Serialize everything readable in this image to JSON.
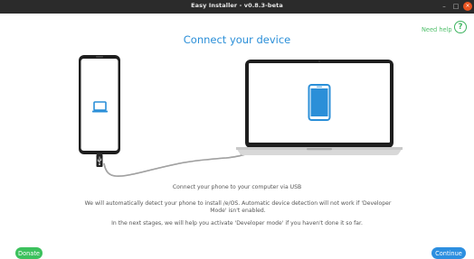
{
  "window": {
    "title": "Easy Installer - v0.8.3-beta",
    "minimize_glyph": "–",
    "maximize_glyph": "□",
    "close_glyph": "×"
  },
  "header": {
    "help_label": "Need help",
    "help_icon_glyph": "?",
    "title": "Connect your device"
  },
  "content": {
    "connect_text": "Connect your phone to your computer via USB",
    "detect_text": "We will automatically detect your phone to install /e/OS. Automatic device detection will not work if 'Developer Mode' isn't enabled.",
    "stages_text": "In the next stages, we will help you activate 'Developer mode' if you haven't done it so far."
  },
  "footer": {
    "donate_label": "Donate",
    "continue_label": "Continue"
  },
  "colors": {
    "accent_blue": "#2b8fd8",
    "accent_green": "#3cc15d",
    "titlebar": "#2b2b2b",
    "close_button": "#e95420"
  },
  "icons": {
    "help": "question-circle-icon",
    "phone_screen": "laptop-icon",
    "laptop_screen": "smartphone-icon",
    "usb": "usb-icon"
  }
}
